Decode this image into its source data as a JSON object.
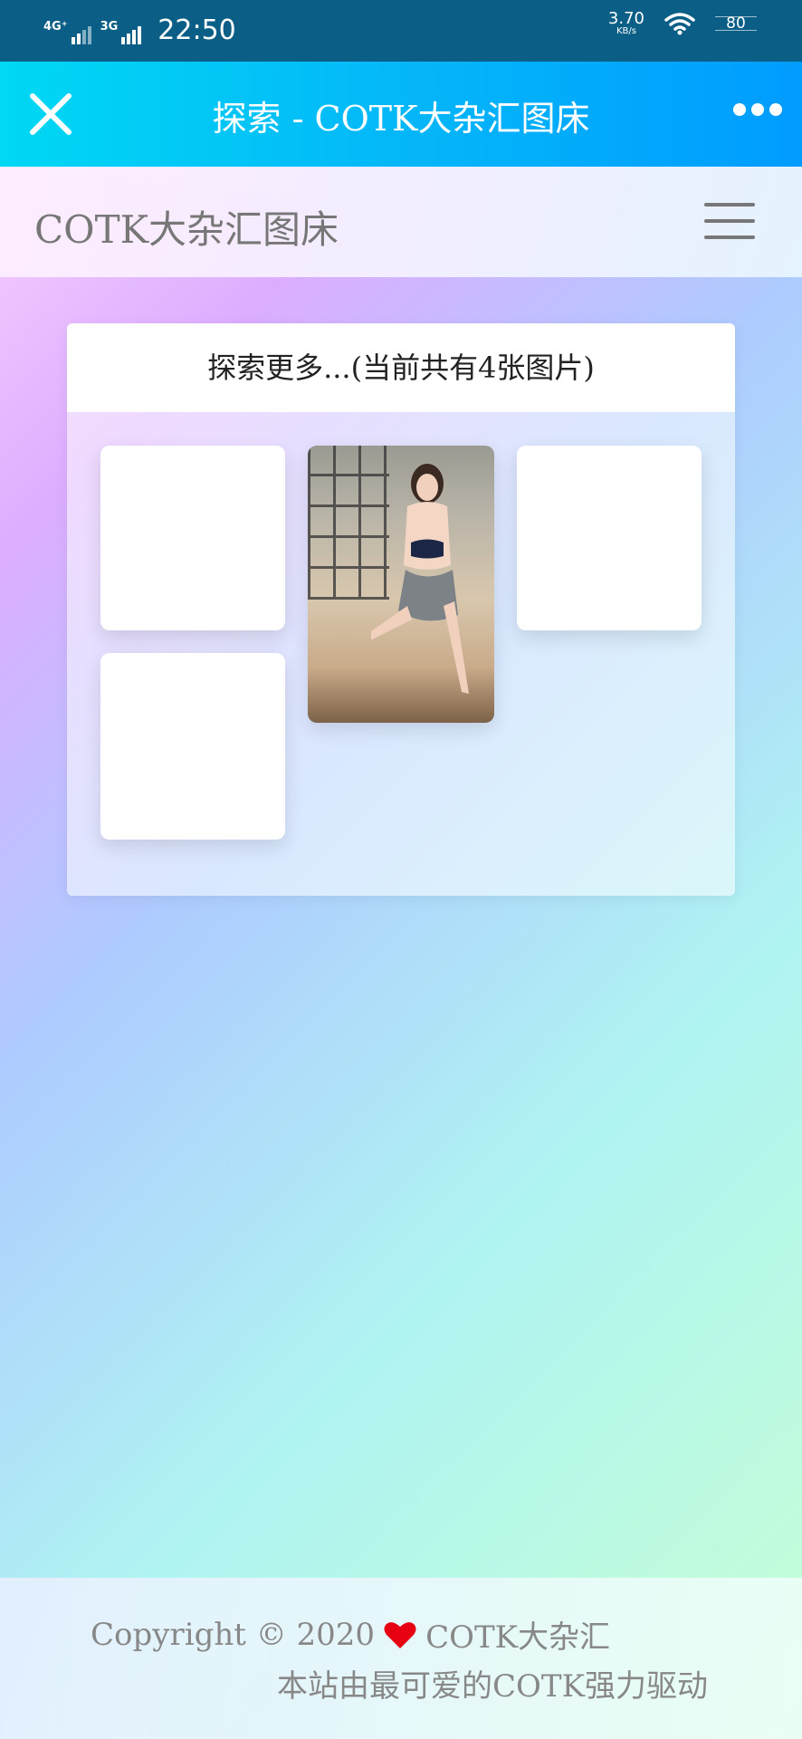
{
  "status_bar": {
    "network1": "4G⁺",
    "network2": "3G",
    "time": "22:50",
    "speed_value": "3.70",
    "speed_unit": "KB/s",
    "battery": "80"
  },
  "title_bar": {
    "title": "探索 - COTK大杂汇图床"
  },
  "site_header": {
    "brand": "COTK大杂汇图床"
  },
  "card": {
    "header": "探索更多...(当前共有4张图片)"
  },
  "footer": {
    "copyright_text": "Copyright © 2020",
    "copyright_brand": "COTK大杂汇",
    "powered_by": "本站由最可爱的COTK强力驱动"
  },
  "colors": {
    "heart": "#e60012",
    "title_gradient_start": "#00d8f4",
    "title_gradient_end": "#009cff"
  }
}
